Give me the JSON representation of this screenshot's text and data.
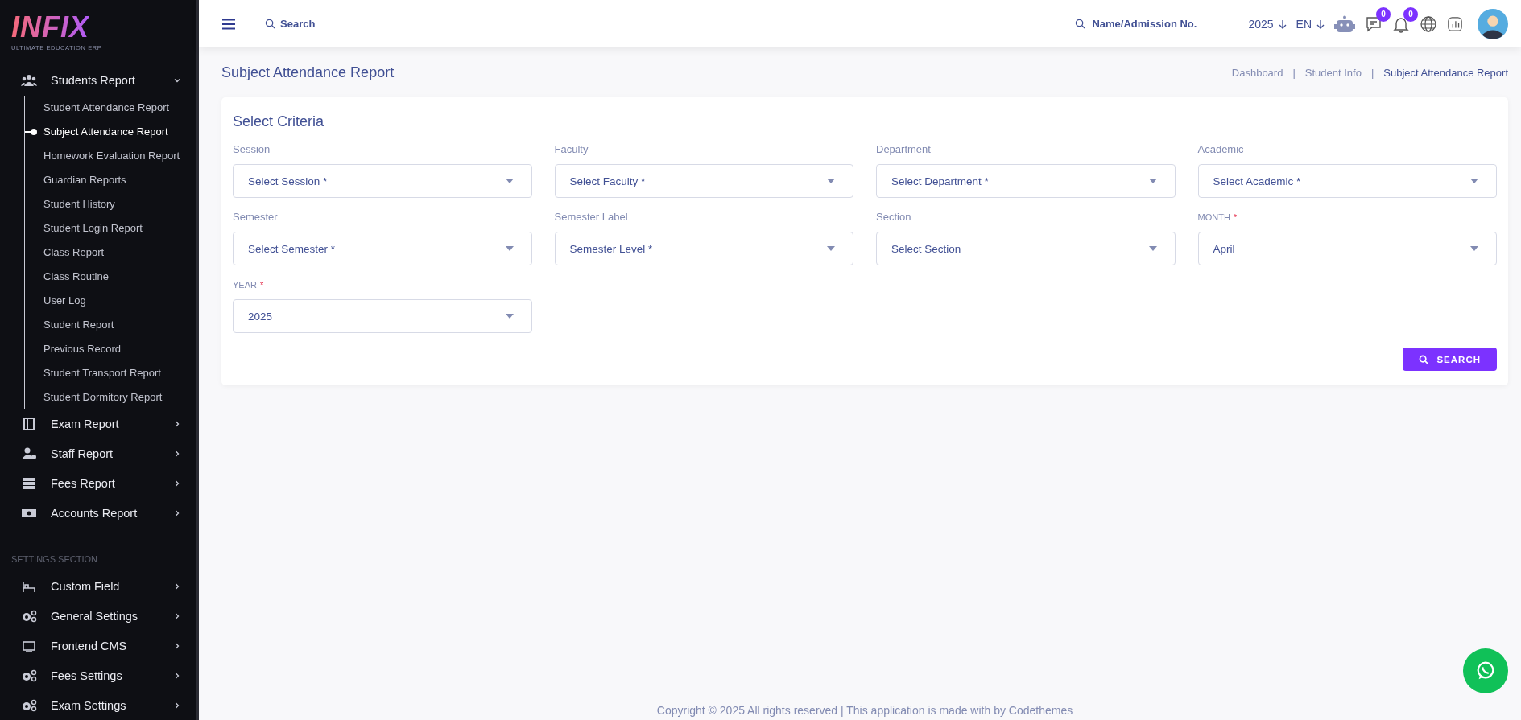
{
  "logo": {
    "name": "INFIX",
    "tagline": "ULTIMATE EDUCATION ERP"
  },
  "sidebar": {
    "sections": [
      {
        "items": [
          {
            "label": "Students Report",
            "expanded": true,
            "children": [
              {
                "label": "Student Attendance Report",
                "selected": false
              },
              {
                "label": "Subject Attendance Report",
                "selected": true
              },
              {
                "label": "Homework Evaluation Report",
                "selected": false
              },
              {
                "label": "Guardian Reports",
                "selected": false
              },
              {
                "label": "Student History",
                "selected": false
              },
              {
                "label": "Student Login Report",
                "selected": false
              },
              {
                "label": "Class Report",
                "selected": false
              },
              {
                "label": "Class Routine",
                "selected": false
              },
              {
                "label": "User Log",
                "selected": false
              },
              {
                "label": "Student Report",
                "selected": false
              },
              {
                "label": "Previous Record",
                "selected": false
              },
              {
                "label": "Student Transport Report",
                "selected": false
              },
              {
                "label": "Student Dormitory Report",
                "selected": false
              }
            ]
          },
          {
            "label": "Exam Report",
            "expanded": false
          },
          {
            "label": "Staff Report",
            "expanded": false
          },
          {
            "label": "Fees Report",
            "expanded": false
          },
          {
            "label": "Accounts Report",
            "expanded": false
          }
        ]
      },
      {
        "title": "SETTINGS SECTION",
        "items": [
          {
            "label": "Custom Field",
            "expanded": false
          },
          {
            "label": "General Settings",
            "expanded": false
          },
          {
            "label": "Frontend CMS",
            "expanded": false
          },
          {
            "label": "Fees Settings",
            "expanded": false
          },
          {
            "label": "Exam Settings",
            "expanded": false
          }
        ]
      }
    ]
  },
  "topbar": {
    "search_label": "Search",
    "student_search": {
      "placeholder": "Name/Admission No."
    },
    "year": "2025",
    "language": "EN",
    "chat_badge": "0",
    "notification_badge": "0"
  },
  "page": {
    "title": "Subject Attendance Report",
    "breadcrumb": [
      {
        "label": "Dashboard",
        "current": false
      },
      {
        "label": "Student Info",
        "current": false
      },
      {
        "label": "Subject Attendance Report",
        "current": true
      }
    ],
    "breadcrumb_separators": [
      "|",
      "|"
    ]
  },
  "criteria": {
    "title": "Select Criteria",
    "fields": [
      {
        "label": "Session",
        "required": false,
        "placeholder": "Select Session *"
      },
      {
        "label": "Faculty",
        "required": false,
        "placeholder": "Select Faculty *"
      },
      {
        "label": "Department",
        "required": false,
        "placeholder": "Select Department *"
      },
      {
        "label": "Academic",
        "required": false,
        "placeholder": "Select Academic *"
      },
      {
        "label": "Semester",
        "required": false,
        "placeholder": "Select Semester *"
      },
      {
        "label": "Semester Label",
        "required": false,
        "placeholder": "Semester Level *"
      },
      {
        "label": "Section",
        "required": false,
        "placeholder": "Select Section"
      },
      {
        "label": "MONTH",
        "required": true,
        "required_mark": "*",
        "value": "April"
      },
      {
        "label": "YEAR",
        "required": true,
        "required_mark": "*",
        "value": "2025"
      }
    ],
    "button": "SEARCH"
  },
  "footer": "Copyright © 2025 All rights reserved | This application is made with by Codethemes"
}
